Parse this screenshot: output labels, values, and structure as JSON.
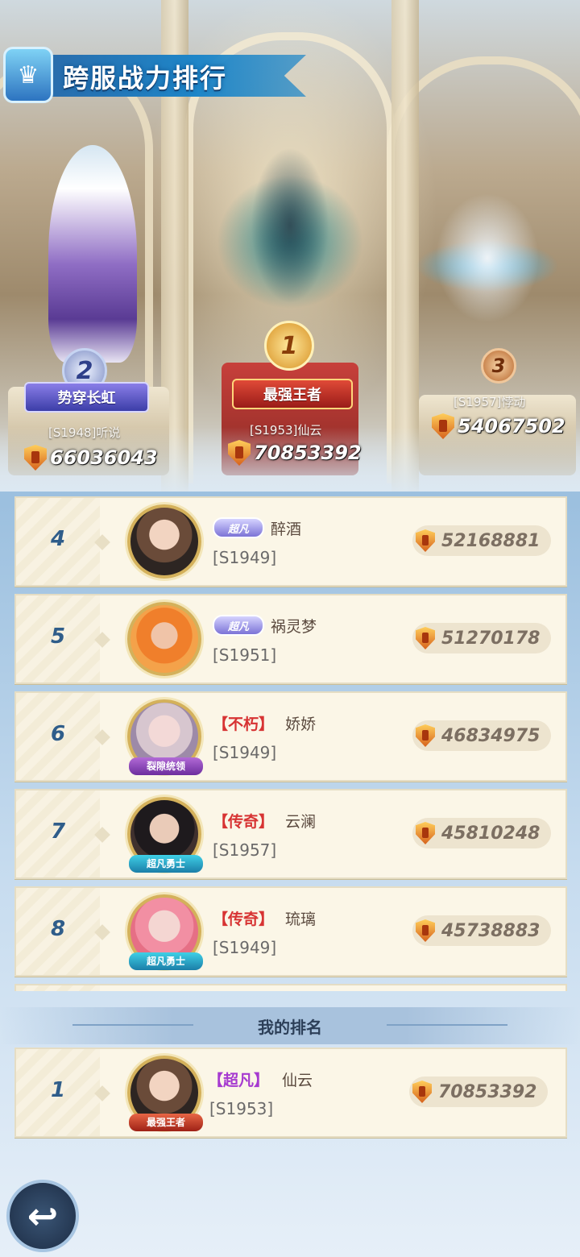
{
  "header": {
    "title": "跨服战力排行"
  },
  "podium": [
    {
      "rank": "2",
      "title": "势穿长虹",
      "name": "[S1948]听说",
      "power": "66036043"
    },
    {
      "rank": "1",
      "title": "最强王者",
      "name": "[S1953]仙云",
      "power": "70853392"
    },
    {
      "rank": "3",
      "title": "",
      "name": "[S1957]悖动",
      "power": "54067502"
    }
  ],
  "list": [
    {
      "rank": "4",
      "badge": "超凡",
      "name": "醉酒",
      "server": "[S1949]",
      "power": "52168881",
      "avatar_tag": ""
    },
    {
      "rank": "5",
      "badge": "超凡",
      "name": "祸灵梦",
      "server": "[S1951]",
      "power": "51270178",
      "avatar_tag": ""
    },
    {
      "rank": "6",
      "badge": "【不朽】",
      "name": "娇娇",
      "server": "[S1949]",
      "power": "46834975",
      "avatar_tag": "裂隙统领"
    },
    {
      "rank": "7",
      "badge": "【传奇】",
      "name": "云澜",
      "server": "[S1957]",
      "power": "45810248",
      "avatar_tag": "超凡勇士"
    },
    {
      "rank": "8",
      "badge": "【传奇】",
      "name": "琉璃",
      "server": "[S1949]",
      "power": "45738883",
      "avatar_tag": "超凡勇士"
    }
  ],
  "my_rank": {
    "label": "我的排名",
    "rank": "1",
    "badge": "【超凡】",
    "name": "仙云",
    "server": "[S1953]",
    "power": "70853392",
    "avatar_tag": "最强王者"
  },
  "back_icon": "↩",
  "icons": {
    "power": "shield-power-icon",
    "back": "back-arrow-icon"
  }
}
